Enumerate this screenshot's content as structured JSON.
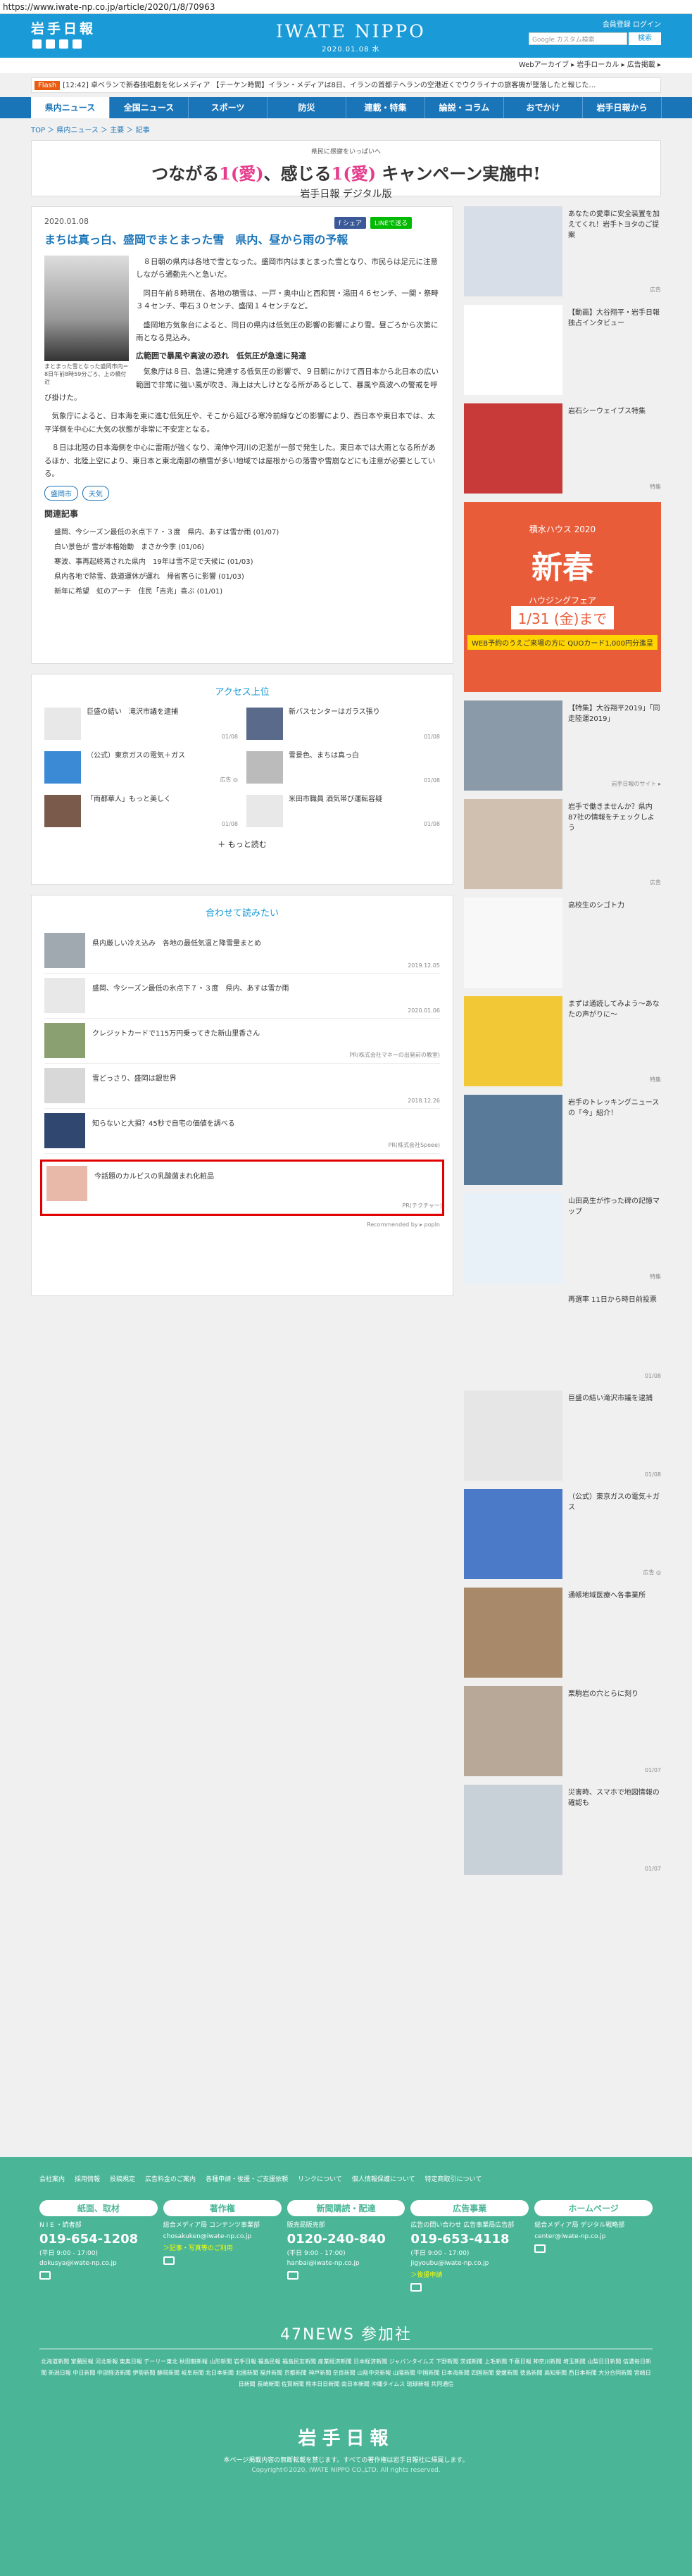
{
  "url": "https://www.iwate-np.co.jp/article/2020/1/8/70963",
  "header": {
    "logo": "岩手日報",
    "site_title": "IWATE NIPPO",
    "date": "2020.01.08 水",
    "links": "会員登録  ログイン",
    "search_placeholder": "Google カスタム検索",
    "search_button": "検索",
    "subline": "Webアーカイブ ▸  岩手ローカル ▸  広告掲載 ▸"
  },
  "ticker": {
    "label": "Flash",
    "text": "[12:42] 卓ベランで新春独唱劇を化レメディア  【テーケン時間】イラン・メディアは8日、イランの首都テヘランの空港近くでウクライナの旅客機が墜落したと報じた…"
  },
  "nav": [
    "県内ニュース",
    "全国ニュース",
    "スポーツ",
    "防災",
    "連載・特集",
    "論説・コラム",
    "おでかけ",
    "岩手日報から"
  ],
  "breadcrumb": "TOP ＞ 県内ニュース ＞ 主要 ＞ 記事",
  "campaign": {
    "small": "県民に感謝をいっぱいへ",
    "title_a": "つながる",
    "title_b": "1(愛)",
    "title_c": "、感じる",
    "title_d": "1(愛)",
    "title_e": " キャンペーン実施中!",
    "sub": "岩手日報 デジタル版"
  },
  "article": {
    "date": "2020.01.08",
    "share": "f シェア",
    "line": "LINEで送る",
    "title": "まちは真っ白、盛岡でまとまった雪　県内、昼から雨の予報",
    "photo_caption": "まとまった雪となった盛岡市内＝8日午前8時59分ごろ、上の橋付近",
    "paragraphs": [
      "８日朝の県内は各地で雪となった。盛岡市内はまとまった雪となり、市民らは足元に注意しながら通勤先へと急いだ。",
      "同日午前８時現在、各地の積雪は、一戸・奥中山と西和賀・湯田４６センチ、一関・祭畤３４センチ、雫石３０センチ、盛岡１４センチなど。",
      "盛岡地方気象台によると、同日の県内は低気圧の影響の影響により雪。昼ごろから次第に雨となる見込み。",
      "気象庁は８日、急速に発達する低気圧の影響で、９日朝にかけて西日本から北日本の広い範囲で非常に強い風が吹き、海上は大しけとなる所があるとして、暴風や高波への警戒を呼び掛けた。",
      "気象庁によると、日本海を東に進む低気圧や、そこから延びる寒冷前線などの影響により、西日本や東日本では、太平洋側を中心に大気の状態が非常に不安定となる。",
      "８日は北陸の日本海側を中心に雷雨が強くなり、滝伸や河川の氾濫が一部で発生した。東日本では大雨となる所があるほか、北陸上空により、東日本と東北南部の積雪が多い地域では屋根からの落雪や雪崩などにも注意が必要としている。"
    ],
    "subhead": "広範囲で暴風や高波の恐れ　低気圧が急速に発達",
    "tags": [
      "盛岡市",
      "天気"
    ],
    "related_heading": "関連記事",
    "related": [
      "盛岡、今シーズン最低の氷点下７・３度　県内、あすは雪か雨 (01/07)",
      "白い景色が 雪が本格始動　まさか今季 (01/06)",
      "寒波、事再起終焉された県内　19年は雪不足で天候に (01/03)",
      "県内各地で除雪、鉄道運休が運れ　帰省客らに影響 (01/03)",
      "新年に希望　虹のアーチ　住民「吉兆」喜ぶ (01/01)"
    ]
  },
  "access": {
    "title": "アクセス上位",
    "items": [
      {
        "title": "巨盛の結い　滝沢市議を逮捕",
        "date": "01/08"
      },
      {
        "title": "新バスセンターはガラス張り",
        "date": "01/08"
      },
      {
        "title": "（公式）東京ガスの電気＋ガス",
        "date": "広告 ◎"
      },
      {
        "title": "雪景色、まちは真っ白",
        "date": "01/08"
      },
      {
        "title": "「両都華人」もっと美しく",
        "date": "01/08"
      },
      {
        "title": "米田市職員 酒気帯び運転容疑",
        "date": "01/08"
      }
    ],
    "more": "＋ もっと読む"
  },
  "recommend": {
    "title": "合わせて読みたい",
    "items": [
      {
        "title": "県内厳しい冷え込み　各地の最低気温と降雪量まとめ",
        "meta": "2019.12.05"
      },
      {
        "title": "盛岡、今シーズン最低の氷点下７・３度　県内、あすは雪か雨",
        "meta": "2020.01.06"
      },
      {
        "title": "クレジットカードで115万円乗ってきた新山里香さん",
        "meta": "PR(株式会社マネーの出発前の教室)"
      },
      {
        "title": "雪どっさり、盛岡は銀世界",
        "meta": "2018.12.26"
      },
      {
        "title": "知らないと大損？45秒で自宅の価値を調べる",
        "meta": "PR(株式会社Speee)"
      },
      {
        "title": "今話題のカルピスの乳酸菌まれ化粧品",
        "meta": "PR(テクチャー)"
      }
    ],
    "footer": "Recommended by ▸ popln"
  },
  "sidebar": {
    "items": [
      {
        "text": "あなたの愛車に安全装置を加えてくれ！岩手トヨタのご提案",
        "meta": "広告",
        "img": "#d8dee8"
      },
      {
        "text": "【動画】大谷翔平・岩手日報独占インタビュー",
        "meta": "",
        "img": "#ffffff"
      },
      {
        "text": "岩石シーウェイブス特集",
        "meta": "特集",
        "img": "#c83a3a"
      },
      {
        "text": "積水ハウス 2020 新春ハウジングフェア",
        "meta": "",
        "img": "#e85c3a"
      },
      {
        "text": "【特集】大谷翔平2019」「同走陸運2019」",
        "meta": "岩手日報のサイト ▸",
        "img": "#8a9aa8"
      },
      {
        "text": "岩手で働きませんか？県内87社の情報をチェックしよう",
        "meta": "広告",
        "img": "#d0c0b0"
      },
      {
        "text": "高校生のシゴト力",
        "meta": "",
        "img": "#f8f8f8"
      },
      {
        "text": "まずは通読してみよう～あなたの声がりに～",
        "meta": "特集",
        "img": "#f2c836"
      },
      {
        "text": "岩手のトレッキングニュースの「今」紹介！",
        "meta": "",
        "img": "#5a7a9a"
      },
      {
        "text": "山田高生が作った碑の記憶マップ",
        "meta": "特集",
        "img": "#e8f0f8"
      },
      {
        "text": "再選率 11日から時日前投票",
        "meta": "01/08",
        "img": "#f0f0f0"
      },
      {
        "text": "巨盛の結い滝沢市議を逮捕",
        "meta": "01/08",
        "img": "#e6e6e6"
      },
      {
        "text": "（公式）東京ガスの電気＋ガス",
        "meta": "広告 ◎",
        "img": "#4a7ac8"
      },
      {
        "text": "通帳地域医療へ各事業所",
        "meta": "",
        "img": "#a88a6a"
      },
      {
        "text": "栗駒岩の穴とらに刻り",
        "meta": "01/07",
        "img": "#b8a898"
      },
      {
        "text": "災害時、スマホで地図情報の確認も",
        "meta": "01/07",
        "img": "#c8d0d8"
      }
    ],
    "ad_big": {
      "year": "積水ハウス 2020",
      "title": "新春",
      "sub": "ハウジングフェア",
      "date": "1/31 (金)まで",
      "quo": "WEB予約のうえご来場の方に QUOカード1,000円分進呈"
    }
  },
  "footer": {
    "links": [
      "会社案内",
      "採用情報",
      "投稿規定",
      "広告料金のご案内",
      "各種申請・後援・ご支援依頼",
      "リンクについて",
      "個人情報保護について",
      "特定商取引について"
    ],
    "cols": [
      {
        "h": "紙面、取材",
        "sub": "N I E ・読者部",
        "phone": "019-654-1208",
        "time": "(平日 9:00 - 17:00)",
        "mail": "dokusya@iwate-np.co.jp",
        "note": ""
      },
      {
        "h": "著作権",
        "sub": "総合メディア局 コンテンツ事業部",
        "phone": "",
        "time": "",
        "mail": "chosakuken@iwate-np.co.jp",
        "note": "＞記事・写真等のご利用"
      },
      {
        "h": "新聞購読・配達",
        "sub": "販売局販売部",
        "phone": "0120-240-840",
        "time": "(平日 9:00 - 17:00)",
        "mail": "hanbai@iwate-np.co.jp",
        "note": ""
      },
      {
        "h": "広告事業",
        "sub": "広告の問い合わせ 広告事業局広告部",
        "phone": "019-653-4118",
        "time": "(平日 9:00 - 17:00)",
        "mail": "jigyoubu@iwate-np.co.jp",
        "note": "＞後援申請"
      },
      {
        "h": "ホームページ",
        "sub": "総合メディア局 デジタル戦略部",
        "phone": "",
        "time": "",
        "mail": "center@iwate-np.co.jp",
        "note": ""
      }
    ],
    "n47": "47NEWS 参加社",
    "members": "北海道新聞 室蘭民報 河北新報 東奥日報 デーリー東北 秋田魁新報 山形新聞 岩手日報 福島民報 福島民友新聞 産業経済新聞 日本経済新聞 ジャパンタイムズ 下野新聞 茨城新聞 上毛新聞 千葉日報 神奈川新聞 埼玉新聞 山梨日日新聞 信濃毎日新聞 新潟日報 中日新聞 中部経済新聞 伊勢新聞 静岡新聞 岐阜新聞 北日本新聞 北國新聞 福井新聞 京都新聞 神戸新聞 奈良新聞 山陰中央新報 山陽新聞 中国新聞 日本海新聞 四国新聞 愛媛新聞 徳島新聞 高知新聞 西日本新聞 大分合同新聞 宮崎日日新聞 長崎新聞 佐賀新聞 熊本日日新聞 南日本新聞 沖縄タイムス 琉球新報 共同通信",
    "logo": "岩手日報",
    "copy": "本ページ掲載内容の無断転載を禁じます。すべての著作権は岩手日報社に帰属します。",
    "copy2": "Copyright©2020, IWATE NIPPO CO.,LTD. All rights reserved."
  }
}
